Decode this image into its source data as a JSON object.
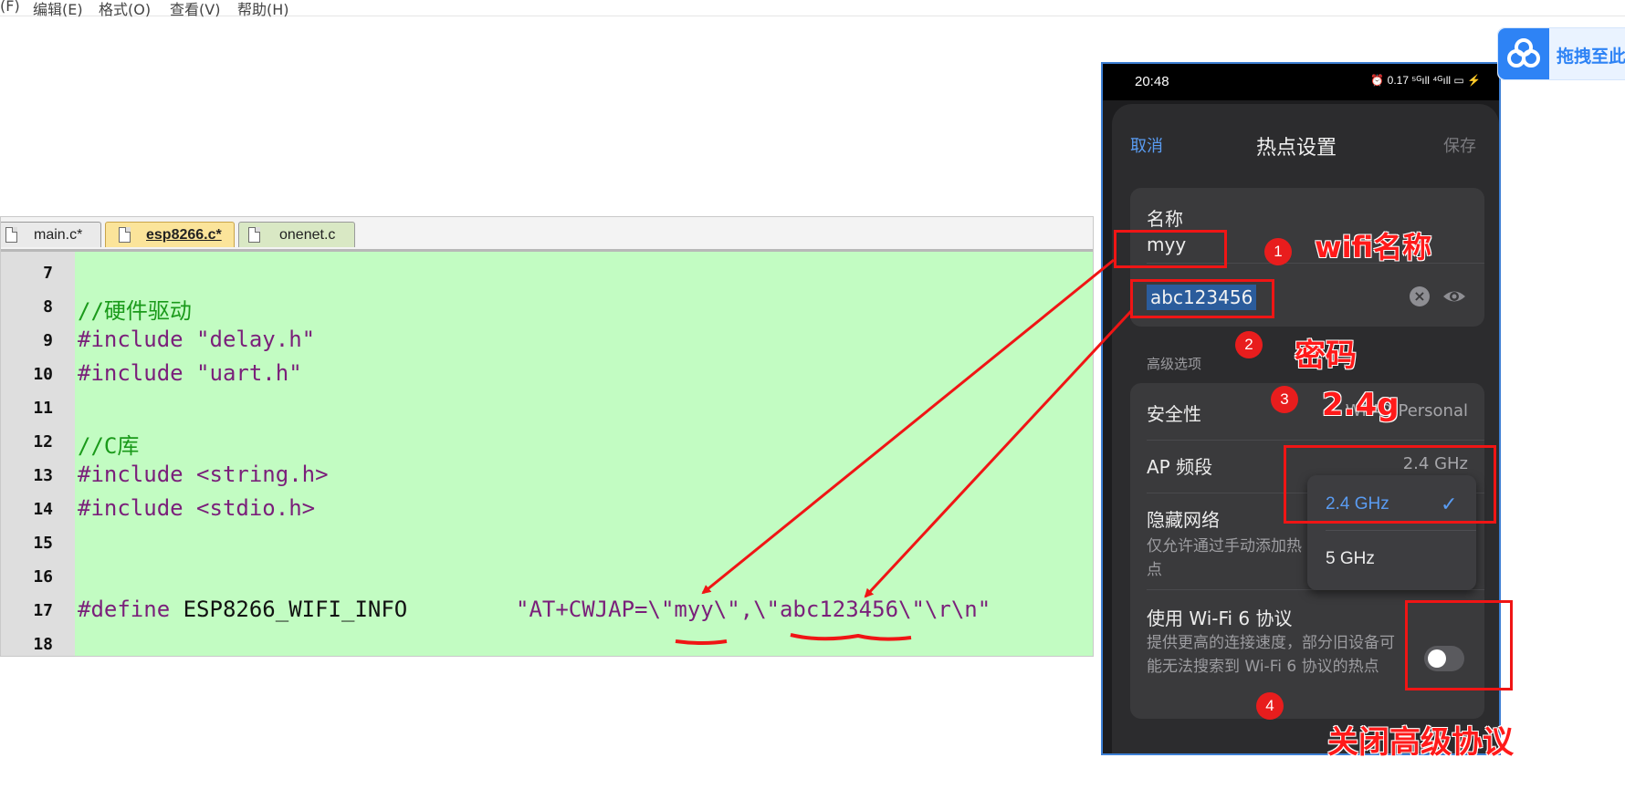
{
  "menu": [
    "(F)",
    "编辑(E)",
    "格式(O)",
    "查看(V)",
    "帮助(H)"
  ],
  "editor": {
    "tabs": [
      {
        "label": "main.c*",
        "active": false
      },
      {
        "label": "esp8266.c*",
        "active": true
      },
      {
        "label": "onenet.c",
        "active": false
      }
    ],
    "lines": [
      {
        "num": "7",
        "text": ""
      },
      {
        "num": "8",
        "text": "//硬件驱动"
      },
      {
        "num": "9",
        "directive": "#include",
        "arg": " \"delay.h\""
      },
      {
        "num": "10",
        "directive": "#include",
        "arg": " \"uart.h\""
      },
      {
        "num": "11",
        "text": ""
      },
      {
        "num": "12",
        "text": "//C库"
      },
      {
        "num": "13",
        "directive": "#include",
        "arg": " <string.h>"
      },
      {
        "num": "14",
        "directive": "#include",
        "arg": " <stdio.h>"
      },
      {
        "num": "15",
        "text": ""
      },
      {
        "num": "16",
        "text": ""
      },
      {
        "num": "17",
        "directive": "#define",
        "name": " ESP8266_WIFI_INFO",
        "value": "\"AT+CWJAP=\\\"myy\\\",\\\"abc123456\\\"\\r\\n\""
      },
      {
        "num": "18",
        "text": ""
      }
    ]
  },
  "phone": {
    "status": {
      "time": "20:48",
      "icons": "⏰ 0.17 ⁵ᴳıll ⁴ᴳıll ▭ ⚡"
    },
    "header": {
      "cancel": "取消",
      "title": "热点设置",
      "save": "保存"
    },
    "name_label": "名称",
    "ssid": "myy",
    "password": "abc123456",
    "advanced_label": "高级选项",
    "security_label": "安全性",
    "security_value": "WPA2-Personal",
    "band_label": "AP 频段",
    "band_value": "2.4 GHz",
    "hidden_label": "隐藏网络",
    "hidden_desc": "仅允许通过手动添加热点",
    "wifi6_label": "使用 Wi-Fi 6 协议",
    "wifi6_desc": "提供更高的连接速度，部分旧设备可能无法搜索到 Wi-Fi 6 协议的热点",
    "wifi6_enabled": false,
    "band_options": [
      {
        "label": "2.4 GHz",
        "selected": true
      },
      {
        "label": "5 GHz",
        "selected": false
      }
    ],
    "check_icon": "✓"
  },
  "cloud_button": {
    "label": "拖拽至此"
  },
  "annotations": {
    "wifi_name": "wifi名称",
    "password": "密码",
    "band": "2.4g",
    "advanced": "关闭高级协议",
    "badges": [
      "1",
      "2",
      "3",
      "4"
    ]
  },
  "colors": {
    "code_bg": "#c2fcc2",
    "annotation": "#ff1a1a",
    "accent": "#5a9cf2"
  }
}
